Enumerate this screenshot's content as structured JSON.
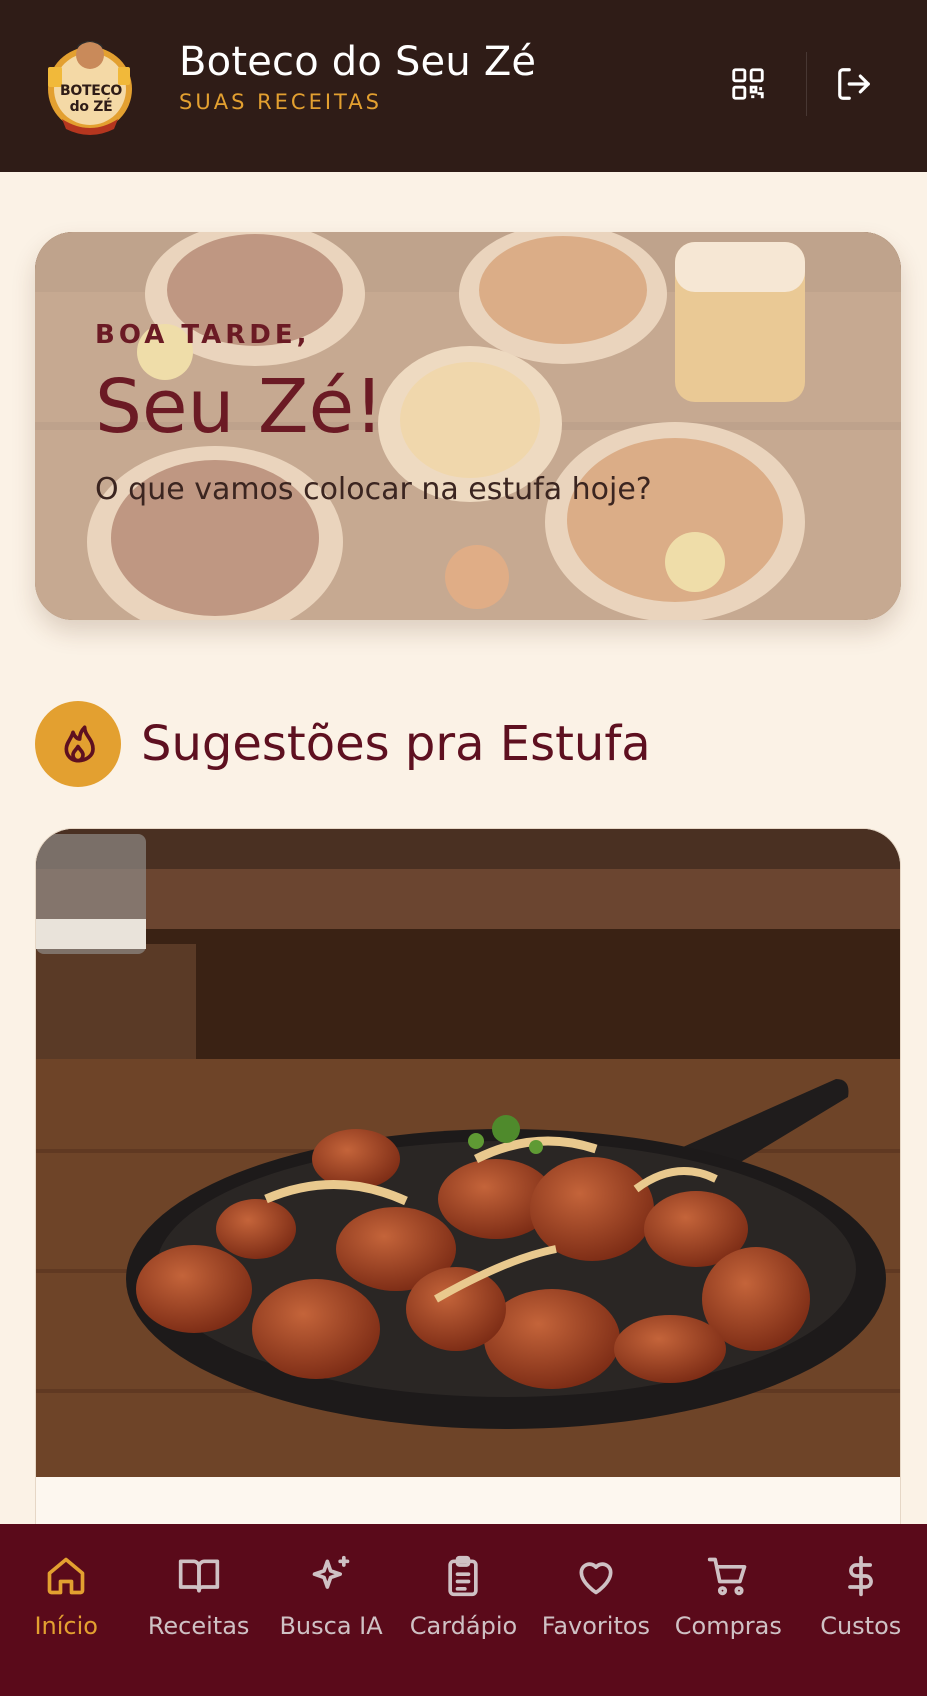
{
  "header": {
    "logo_text": "BOTECO do ZÉ",
    "title": "Boteco do Seu Zé",
    "subtitle": "SUAS RECEITAS",
    "icons": [
      "qr-code-icon",
      "logout-icon"
    ]
  },
  "hero": {
    "greeting": "BOA TARDE,",
    "name": "Seu Zé!",
    "question": "O que vamos colocar na estufa hoje?"
  },
  "section": {
    "icon": "flame-icon",
    "title": "Sugestões pra Estufa"
  },
  "nav": {
    "items": [
      {
        "label": "Início",
        "icon": "home-icon",
        "active": true
      },
      {
        "label": "Receitas",
        "icon": "book-icon",
        "active": false
      },
      {
        "label": "Busca IA",
        "icon": "sparkles-icon",
        "active": false
      },
      {
        "label": "Cardápio",
        "icon": "clipboard-icon",
        "active": false
      },
      {
        "label": "Favoritos",
        "icon": "heart-icon",
        "active": false
      },
      {
        "label": "Compras",
        "icon": "cart-icon",
        "active": false
      },
      {
        "label": "Custos",
        "icon": "dollar-icon",
        "active": false
      }
    ]
  },
  "colors": {
    "header_bg": "#2f1c17",
    "accent": "#e3a030",
    "wine": "#5a0a1a",
    "page_bg": "#fbf2e6"
  }
}
